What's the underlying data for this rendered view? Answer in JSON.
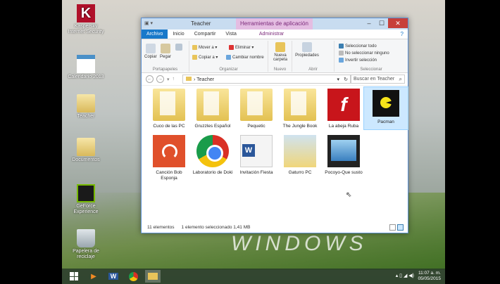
{
  "desktop_icons": [
    {
      "label": "Kaspersky Internet Security",
      "icon": "kaspersky-icon",
      "glyph": "K"
    },
    {
      "label": "Calendario 2013",
      "icon": "calendar-icon"
    },
    {
      "label": "Teacher",
      "icon": "document-icon"
    },
    {
      "label": "Documentos",
      "icon": "document-icon"
    },
    {
      "label": "GeForce Experience",
      "icon": "nvidia-icon"
    },
    {
      "label": "Papelera de reciclaje",
      "icon": "recycle-bin-icon"
    }
  ],
  "wallpaper_text": "WINDOWS",
  "window": {
    "title": "Teacher",
    "context_tab_header": "Herramientas de aplicación",
    "buttons": {
      "minimize": "–",
      "maximize": "☐",
      "close": "✕"
    },
    "tabs": {
      "file": "Archivo",
      "home": "Inicio",
      "share": "Compartir",
      "view": "Vista",
      "manage": "Administrar",
      "help": "?"
    },
    "ribbon": {
      "clipboard": {
        "copy": "Copiar",
        "paste": "Pegar",
        "label": "Portapapeles"
      },
      "organize": {
        "move_to": "Mover a ▾",
        "copy_to": "Copiar a ▾",
        "delete": "Eliminar ▾",
        "rename": "Cambiar nombre",
        "label": "Organizar"
      },
      "new": {
        "new_folder": "Nueva carpeta",
        "label": "Nuevo"
      },
      "open": {
        "properties": "Propiedades",
        "label": "Abrir"
      },
      "select": {
        "select_all": "Seleccionar todo",
        "select_none": "No seleccionar ninguno",
        "invert": "Invertir selección",
        "label": "Seleccionar"
      }
    },
    "address": {
      "path": "Teacher",
      "separator": "›"
    },
    "search": {
      "placeholder": "Buscar en Teacher"
    },
    "items": [
      {
        "label": "Cuco de las PC",
        "kind": "folder"
      },
      {
        "label": "Gruzzles Español",
        "kind": "folder"
      },
      {
        "label": "Pequetic",
        "kind": "folder"
      },
      {
        "label": "The Jungle Book",
        "kind": "folder"
      },
      {
        "label": "La abeja Ruba",
        "kind": "flash",
        "glyph": "f"
      },
      {
        "label": "Pacman",
        "kind": "pacman",
        "selected": true
      },
      {
        "label": "Canción Bob Esponja",
        "kind": "music"
      },
      {
        "label": "Laboratorio de Doki",
        "kind": "chrome"
      },
      {
        "label": "Invitación Fiesta",
        "kind": "word"
      },
      {
        "label": "Gaturro PC",
        "kind": "image"
      },
      {
        "label": "Pocoyo-Que susto",
        "kind": "video"
      }
    ],
    "status": {
      "count": "11 elementos",
      "selection": "1 elemento seleccionado  1,41 MB"
    }
  },
  "taskbar": {
    "time": "11:07 a. m.",
    "date": "05/05/2015"
  },
  "colors": {
    "accent": "#1979ca",
    "close": "#c7403a",
    "context": "#7b2a7a",
    "selection": "#cce8ff"
  }
}
